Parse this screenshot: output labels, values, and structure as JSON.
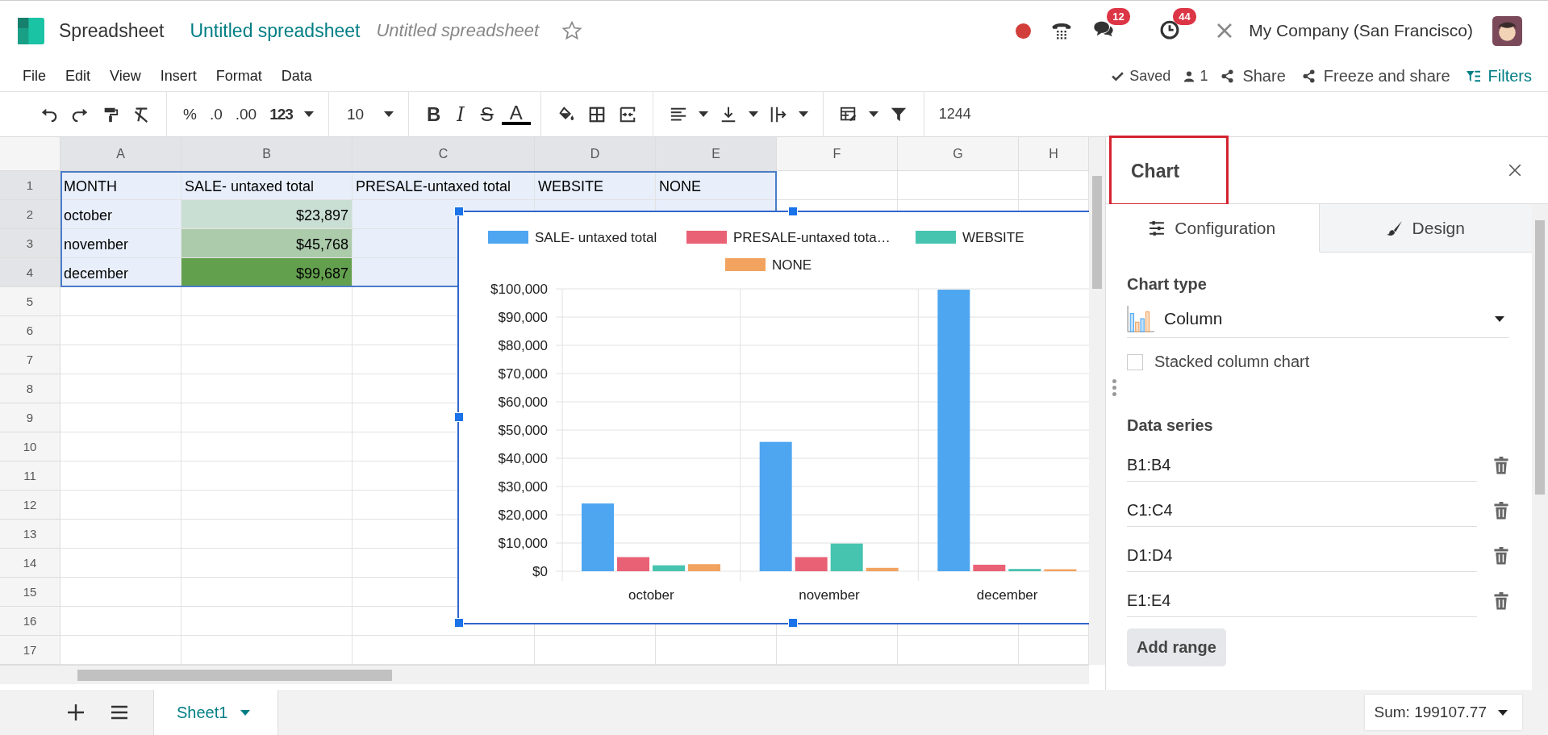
{
  "app": {
    "name": "Spreadsheet",
    "document_title": "Untitled spreadsheet",
    "document_name": "Untitled spreadsheet"
  },
  "systray": {
    "messages_count": "12",
    "activities_count": "44",
    "company": "My Company (San Francisco)"
  },
  "menu": [
    "File",
    "Edit",
    "View",
    "Insert",
    "Format",
    "Data"
  ],
  "status": {
    "saved": "Saved",
    "users": "1",
    "share": "Share",
    "freeze": "Freeze and share",
    "filters": "Filters"
  },
  "toolbar": {
    "number_formats": [
      "%",
      ".0",
      ".00",
      "123"
    ],
    "font_size": "10",
    "text_styles": [
      {
        "label": "B",
        "kind": "bold"
      },
      {
        "label": "I",
        "kind": "italic"
      },
      {
        "label": "S",
        "kind": "strike"
      },
      {
        "label": "A",
        "kind": "color"
      }
    ],
    "formula": "1244"
  },
  "grid": {
    "columns": [
      {
        "label": "A",
        "selected": true
      },
      {
        "label": "B",
        "selected": true
      },
      {
        "label": "C",
        "selected": true
      },
      {
        "label": "D",
        "selected": true
      },
      {
        "label": "E",
        "selected": true
      },
      {
        "label": "F",
        "selected": false
      },
      {
        "label": "G",
        "selected": false
      },
      {
        "label": "H",
        "selected": false
      }
    ],
    "rows": [
      {
        "number": "1",
        "selected": true,
        "cells": [
          {
            "text": "MONTH",
            "kind": "text"
          },
          {
            "text": "SALE- untaxed total",
            "kind": "text"
          },
          {
            "text": "PRESALE-untaxed total",
            "kind": "text"
          },
          {
            "text": "WEBSITE",
            "kind": "text"
          },
          {
            "text": "NONE",
            "kind": "text"
          }
        ]
      },
      {
        "number": "2",
        "selected": true,
        "cells": [
          {
            "text": "october",
            "kind": "text"
          },
          {
            "text": "$23,897",
            "kind": "number",
            "color": "#cadfd3"
          }
        ]
      },
      {
        "number": "3",
        "selected": true,
        "cells": [
          {
            "text": "november",
            "kind": "text"
          },
          {
            "text": "$45,768",
            "kind": "number",
            "color": "#abcbab"
          }
        ]
      },
      {
        "number": "4",
        "selected": true,
        "cells": [
          {
            "text": "december",
            "kind": "text"
          },
          {
            "text": "$99,687",
            "kind": "number",
            "color": "#63a04e"
          }
        ]
      },
      {
        "number": "5",
        "selected": false,
        "cells": []
      },
      {
        "number": "6",
        "selected": false,
        "cells": []
      },
      {
        "number": "7",
        "selected": false,
        "cells": []
      },
      {
        "number": "8",
        "selected": false,
        "cells": []
      },
      {
        "number": "9",
        "selected": false,
        "cells": []
      },
      {
        "number": "10",
        "selected": false,
        "cells": []
      },
      {
        "number": "11",
        "selected": false,
        "cells": []
      },
      {
        "number": "12",
        "selected": false,
        "cells": []
      },
      {
        "number": "13",
        "selected": false,
        "cells": []
      },
      {
        "number": "14",
        "selected": false,
        "cells": []
      },
      {
        "number": "15",
        "selected": false,
        "cells": []
      },
      {
        "number": "16",
        "selected": false,
        "cells": []
      },
      {
        "number": "17",
        "selected": false,
        "cells": []
      }
    ]
  },
  "chart": {
    "chart_data": {
      "type": "bar",
      "grid": true,
      "legend": "top",
      "categories": [
        "october",
        "november",
        "december"
      ],
      "series": [
        {
          "name": "SALE- untaxed total",
          "color": "#4ea6f0",
          "values": [
            24000,
            45800,
            99700
          ]
        },
        {
          "name": "PRESALE-untaxed tota…",
          "color": "#e96175",
          "values": [
            5000,
            5000,
            2300
          ]
        },
        {
          "name": "WEBSITE",
          "color": "#47c4b0",
          "values": [
            2100,
            9800,
            800
          ]
        },
        {
          "name": "NONE",
          "color": "#f2a35f",
          "values": [
            2500,
            1200,
            700
          ]
        }
      ],
      "ylim": [
        0,
        100000
      ],
      "yticks": [
        {
          "value": 0,
          "label": "$0"
        },
        {
          "value": 10000,
          "label": "$10,000"
        },
        {
          "value": 20000,
          "label": "$20,000"
        },
        {
          "value": 30000,
          "label": "$30,000"
        },
        {
          "value": 40000,
          "label": "$40,000"
        },
        {
          "value": 50000,
          "label": "$50,000"
        },
        {
          "value": 60000,
          "label": "$60,000"
        },
        {
          "value": 70000,
          "label": "$70,000"
        },
        {
          "value": 80000,
          "label": "$80,000"
        },
        {
          "value": 90000,
          "label": "$90,000"
        },
        {
          "value": 100000,
          "label": "$100,000"
        }
      ]
    }
  },
  "panel": {
    "title": "Chart",
    "tabs": [
      {
        "label": "Configuration",
        "kind": "config",
        "selected": true
      },
      {
        "label": "Design",
        "kind": "design",
        "selected": false
      }
    ],
    "chart_type_label": "Chart type",
    "chart_type": "Column",
    "stacked": {
      "label": "Stacked column chart",
      "checked": false
    },
    "data_series_label": "Data series",
    "ranges": [
      "B1:B4",
      "C1:C4",
      "D1:D4",
      "E1:E4"
    ],
    "add_range": "Add range"
  },
  "bottom": {
    "sheets": [
      {
        "name": "Sheet1",
        "selected": true
      }
    ],
    "sum": "Sum: 199107.77"
  }
}
